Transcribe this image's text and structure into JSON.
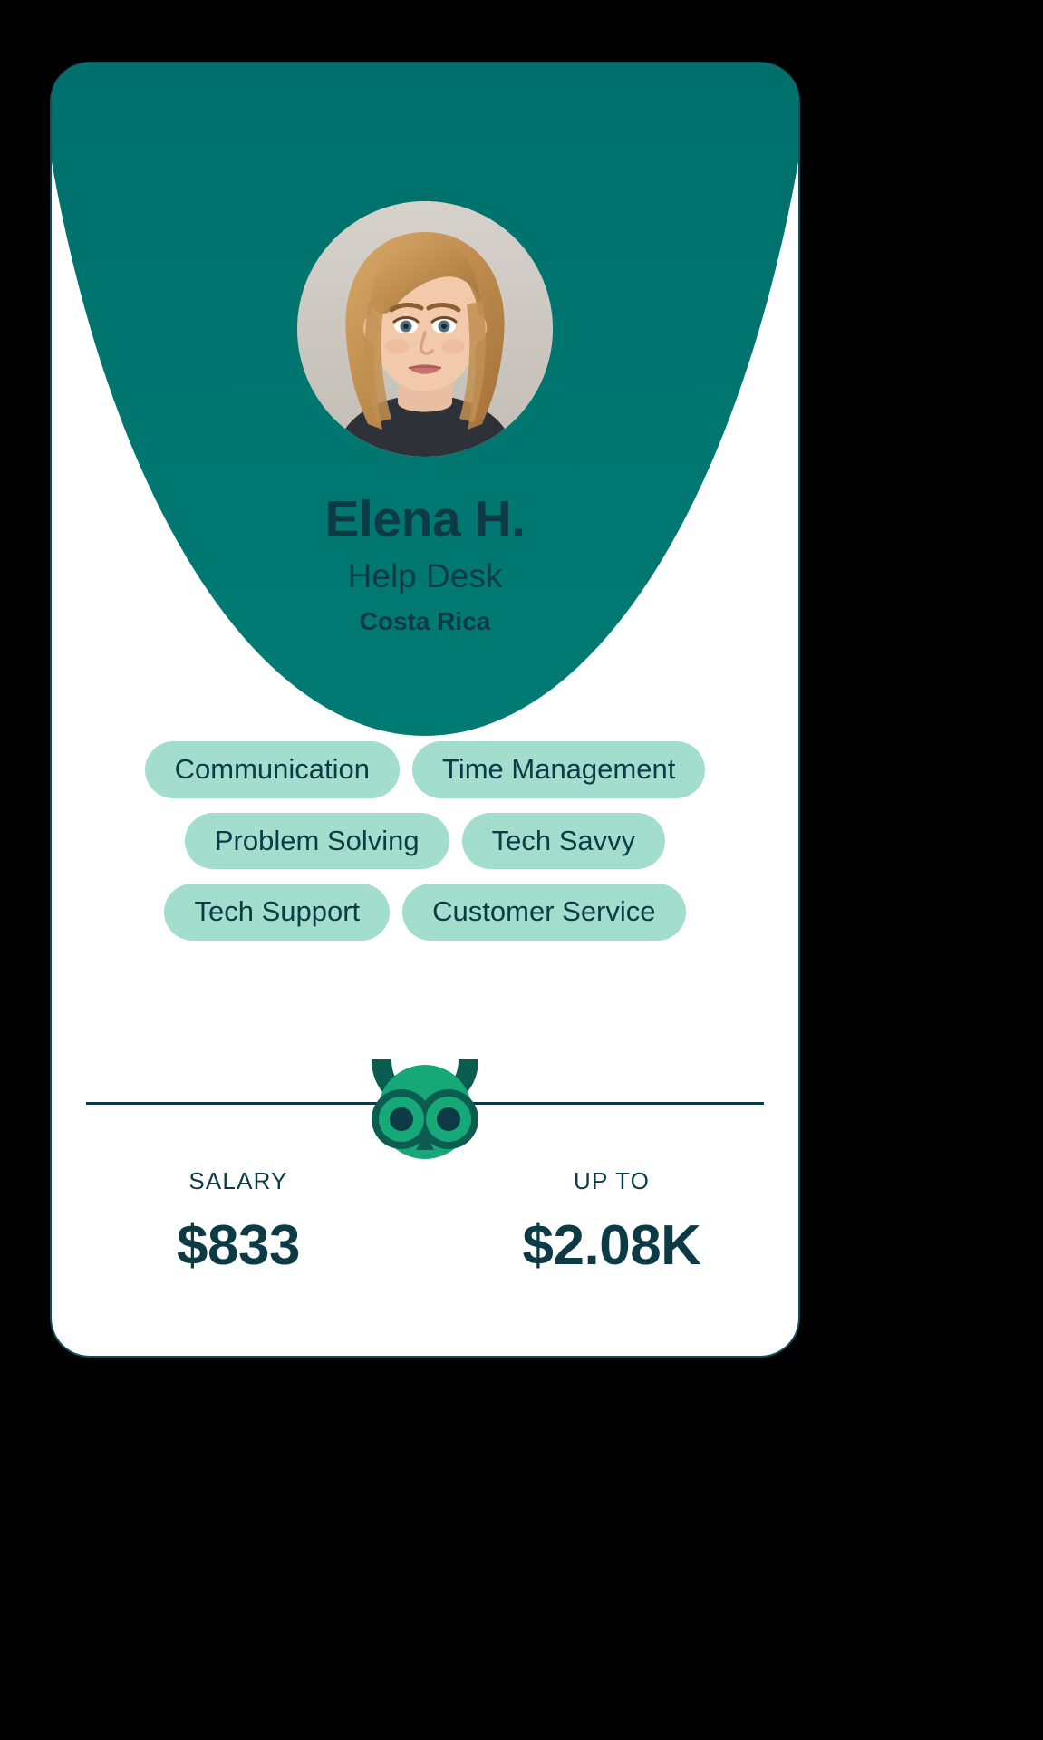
{
  "card": {
    "background_color": "#ffffff",
    "border_color": "#0d4f5c",
    "header_color": "#006b6a"
  },
  "avatar": {
    "icon": "avatar-photo",
    "alt": "Elena H."
  },
  "profile": {
    "name": "Elena H.",
    "role": "Help Desk",
    "country": "Costa Rica",
    "text_color": "#0d3b45"
  },
  "skills": {
    "pill_color": "#a2ddcd",
    "items": [
      {
        "label": "Communication"
      },
      {
        "label": "Time Management"
      },
      {
        "label": "Problem Solving"
      },
      {
        "label": "Tech Savvy"
      },
      {
        "label": "Tech Support"
      },
      {
        "label": "Customer Service"
      }
    ]
  },
  "divider": {
    "icon": "owl-logo-icon",
    "line_color": "#0d3b45",
    "owl_body_color": "#17a878",
    "owl_dark_color": "#0b5d51",
    "owl_pupil_color": "#0d3b45"
  },
  "salary": {
    "columns": [
      {
        "label": "SALARY",
        "value": "$833"
      },
      {
        "label": "UP TO",
        "value": "$2.08K"
      }
    ]
  }
}
